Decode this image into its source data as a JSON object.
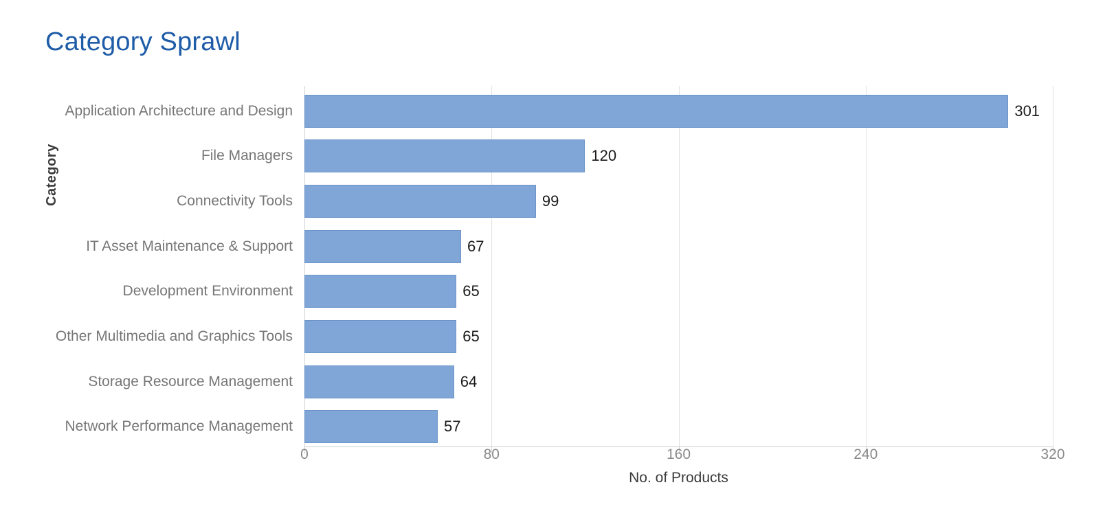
{
  "title": "Category Sprawl",
  "colors": {
    "title": "#1f5ca8",
    "bar": "#7fa6d6",
    "bar_border": "#6b95c9",
    "grid": "#e2e2e2",
    "axis_text": "#8a8a8a",
    "category_text": "#767676",
    "value_text": "#1b1b1b"
  },
  "axes": {
    "x_title": "No. of Products",
    "y_title": "Category",
    "x_ticks": [
      "0",
      "80",
      "160",
      "240",
      "320"
    ]
  },
  "chart_data": {
    "type": "bar",
    "orientation": "horizontal",
    "title": "Category Sprawl",
    "xlabel": "No. of Products",
    "ylabel": "Category",
    "xlim": [
      0,
      320
    ],
    "xticks": [
      0,
      80,
      160,
      240,
      320
    ],
    "grid": true,
    "legend": "none",
    "categories": [
      "Application Architecture and Design",
      "File Managers",
      "Connectivity Tools",
      "IT Asset Maintenance & Support",
      "Development Environment",
      "Other Multimedia and Graphics Tools",
      "Storage Resource Management",
      "Network Performance Management"
    ],
    "values": [
      301,
      120,
      99,
      67,
      65,
      65,
      64,
      57
    ],
    "data_labels": [
      "301",
      "120",
      "99",
      "67",
      "65",
      "65",
      "64",
      "57"
    ]
  }
}
